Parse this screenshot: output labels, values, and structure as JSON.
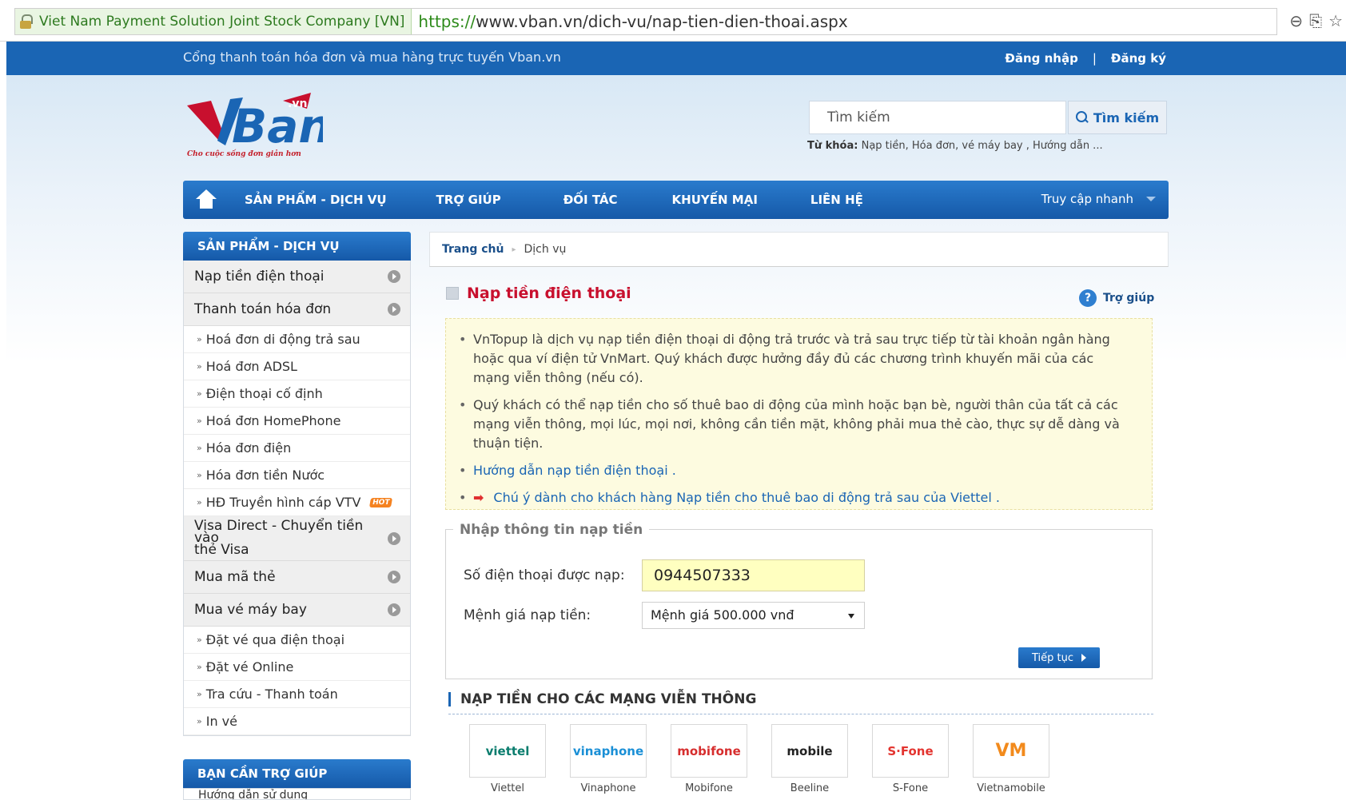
{
  "browser": {
    "ev_label": "Viet Nam Payment Solution Joint Stock Company [VN]",
    "url_scheme": "https://",
    "url_rest": "www.vban.vn/dich-vu/nap-tien-dien-thoai.aspx"
  },
  "topbar": {
    "slogan": "Cổng thanh toán hóa đơn và mua hàng trực tuyến Vban.vn",
    "login": "Đăng nhập",
    "separator": "|",
    "register": "Đăng ký"
  },
  "logo": {
    "brand": "VBan",
    "tld": ".vn",
    "tagline": "Cho cuộc sống đơn giản hơn",
    "colors": {
      "red": "#c8102e",
      "blue": "#1a65b4"
    }
  },
  "search": {
    "placeholder": "Tìm kiếm",
    "button": "Tìm kiếm",
    "keywords_label": "Từ khóa:",
    "keywords": "Nạp tiền, Hóa đơn, vé máy bay , Hướng dẫn ..."
  },
  "nav": {
    "items": [
      "SẢN PHẨM - DỊCH VỤ",
      "TRỢ GIÚP",
      "ĐỐI TÁC",
      "KHUYẾN MẠI",
      "LIÊN HỆ"
    ],
    "quick_access": "Truy cập nhanh"
  },
  "sidebar": {
    "header": "SẢN PHẨM - DỊCH VỤ",
    "cat_topup": "Nạp tiền điện thoại",
    "cat_bills": "Thanh toán hóa đơn",
    "bills_items": [
      "Hoá đơn di động trả sau",
      "Hoá đơn ADSL",
      "Điện thoại cố định",
      "Hoá đơn HomePhone",
      "Hóa đơn điện",
      "Hóa đơn tiền Nước",
      "HĐ Truyền hình cáp VTV"
    ],
    "hot_badge": "HOT",
    "cat_visa_1": "Visa Direct - Chuyển tiền vào",
    "cat_visa_2": "thẻ Visa",
    "cat_card": "Mua mã thẻ",
    "cat_flight": "Mua vé máy bay",
    "flight_items": [
      "Đặt vé qua điện thoại",
      "Đặt vé Online",
      "Tra cứu - Thanh toán",
      "In vé"
    ],
    "help_header": "BẠN CẦN TRỢ GIÚP",
    "help_first": "Hướng dẫn sử dụng"
  },
  "breadcrumb": {
    "home": "Trang chủ",
    "current": "Dịch vụ"
  },
  "main": {
    "title": "Nạp tiền điện thoại",
    "help": "Trợ giúp",
    "notice": [
      "VnTopup là dịch vụ nạp tiền điện thoại di động trả trước và trả sau trực tiếp từ tài khoản ngân hàng hoặc qua ví điện tử VnMart. Quý khách được hưởng đầy đủ các chương trình khuyến mãi của các mạng viễn thông (nếu có).",
      "Quý khách có thể nạp tiền cho số thuê bao di động của mình hoặc bạn bè, người thân của tất cả các mạng viễn thông, mọi lúc, mọi nơi, không cần tiền mặt, không phải mua thẻ cào, thực sự dễ dàng và thuận tiện.",
      "Hướng dẫn nạp tiền điện thoại .",
      "Chú ý dành cho khách hàng Nạp tiền cho thuê bao di động trả sau của Viettel ."
    ],
    "form": {
      "legend": "Nhập thông tin nạp tiền",
      "phone_label": "Số điện thoại được nạp:",
      "phone_value": "0944507333",
      "amount_label": "Mệnh giá nạp tiền:",
      "amount_value": "Mệnh giá 500.000 vnđ",
      "continue": "Tiếp tục"
    },
    "networks_title": "NẠP TIỀN CHO CÁC MẠNG VIỄN THÔNG",
    "carriers": [
      {
        "name": "Viettel",
        "logo_text": "viettel",
        "color": "#0a7d6e"
      },
      {
        "name": "Vinaphone",
        "logo_text": "vinaphone",
        "color": "#1a8fd6"
      },
      {
        "name": "Mobifone",
        "logo_text": "mobifone",
        "color": "#d62d2d"
      },
      {
        "name": "Beeline",
        "logo_text": "mobile",
        "color": "#222222"
      },
      {
        "name": "S-Fone",
        "logo_text": "S·Fone",
        "color": "#e3342f"
      },
      {
        "name": "Vietnamobile",
        "logo_text": "VM",
        "color": "#f28a1c"
      }
    ]
  }
}
